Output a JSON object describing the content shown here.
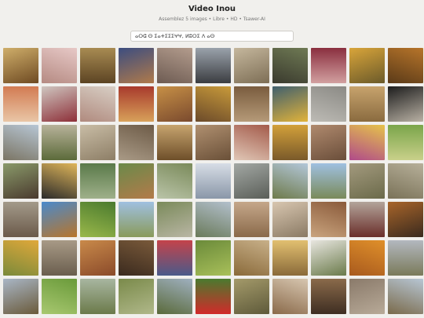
{
  "header": {
    "title": "Video Inou",
    "subtitle": "Assemblez 5 images • Libre • HD • Tsawer-AI"
  },
  "search": {
    "value": "ⴰⵔⵛ ⵙ ⵉⴰⵜⵉⵉⵉⵖⵖ, ⵍⵓⵔⵉ ⴷ ⴰⵙ",
    "placeholder": ""
  },
  "gallery": {
    "tiles": [
      {
        "colors": [
          "#cfae6a",
          "#6e4a22"
        ]
      },
      {
        "colors": [
          "#e7c9c7",
          "#b58a82"
        ]
      },
      {
        "colors": [
          "#a88b52",
          "#5c4423"
        ]
      },
      {
        "colors": [
          "#3c4d80",
          "#b07a4a"
        ]
      },
      {
        "colors": [
          "#b39c8d",
          "#6d5b52"
        ]
      },
      {
        "colors": [
          "#9aa2ab",
          "#3b3d41"
        ]
      },
      {
        "colors": [
          "#c5b79d",
          "#7d6e55"
        ]
      },
      {
        "colors": [
          "#6f7a54",
          "#3a3a2e"
        ]
      },
      {
        "colors": [
          "#8a2f3f",
          "#d2a0a0"
        ]
      },
      {
        "colors": [
          "#d9a53a",
          "#6b5a2a"
        ]
      },
      {
        "colors": [
          "#b7752a",
          "#5a3a18"
        ]
      },
      {
        "colors": [
          "#d27b52",
          "#e9c6a6"
        ]
      },
      {
        "colors": [
          "#cfc6c0",
          "#8d2f38"
        ]
      },
      {
        "colors": [
          "#d8cfc5",
          "#b08a7e"
        ]
      },
      {
        "colors": [
          "#a83a2c",
          "#d8a15a"
        ]
      },
      {
        "colors": [
          "#c79046",
          "#7a4a2e"
        ]
      },
      {
        "colors": [
          "#c89a3a",
          "#6b4a2a"
        ]
      },
      {
        "colors": [
          "#7a5c3e",
          "#b59a78"
        ]
      },
      {
        "colors": [
          "#3f5f6e",
          "#e2b33a"
        ]
      },
      {
        "colors": [
          "#8b8a85",
          "#bdbbb5"
        ]
      },
      {
        "colors": [
          "#c7a36d",
          "#8a6b3f"
        ]
      },
      {
        "colors": [
          "#1c1c1c",
          "#b9b1a4"
        ]
      },
      {
        "colors": [
          "#b7c6d4",
          "#7b7564"
        ]
      },
      {
        "colors": [
          "#b7b29a",
          "#5c6b3a"
        ]
      },
      {
        "colors": [
          "#c9bda6",
          "#8d7e66"
        ]
      },
      {
        "colors": [
          "#6d5b47",
          "#a99a86"
        ]
      },
      {
        "colors": [
          "#c7a46e",
          "#6e4f2a"
        ]
      },
      {
        "colors": [
          "#b09070",
          "#6a5038"
        ]
      },
      {
        "colors": [
          "#a35a4a",
          "#e0c7b6"
        ]
      },
      {
        "colors": [
          "#d2a03a",
          "#7a5a2a"
        ]
      },
      {
        "colors": [
          "#b08a6e",
          "#6a4e3a"
        ]
      },
      {
        "colors": [
          "#e6c34a",
          "#b04a8a"
        ]
      },
      {
        "colors": [
          "#7aa54a",
          "#c9d08a"
        ]
      },
      {
        "colors": [
          "#8a9a6a",
          "#4a3a2e"
        ]
      },
      {
        "colors": [
          "#e0b65a",
          "#2a2a2a"
        ]
      },
      {
        "colors": [
          "#5a7a4a",
          "#9fb08a"
        ]
      },
      {
        "colors": [
          "#6a8a4a",
          "#b37a4a"
        ]
      },
      {
        "colors": [
          "#7a8a5a",
          "#bac4a8"
        ]
      },
      {
        "colors": [
          "#d7dde6",
          "#8a97a8"
        ]
      },
      {
        "colors": [
          "#a3a8a4",
          "#5a5e58"
        ]
      },
      {
        "colors": [
          "#b3c7d9",
          "#6e7a4a"
        ]
      },
      {
        "colors": [
          "#9fc0e0",
          "#7a8a5a"
        ]
      },
      {
        "colors": [
          "#a39a7e",
          "#6b6a4a"
        ]
      },
      {
        "colors": [
          "#b7b09a",
          "#7a7258"
        ]
      },
      {
        "colors": [
          "#a39a8a",
          "#6b5a4a"
        ]
      },
      {
        "colors": [
          "#4a8acc",
          "#b8752a"
        ]
      },
      {
        "colors": [
          "#4a7a2e",
          "#9ab84a"
        ]
      },
      {
        "colors": [
          "#9fc0e0",
          "#8a9a5a"
        ]
      },
      {
        "colors": [
          "#7a8a5a",
          "#b9b6a4"
        ]
      },
      {
        "colors": [
          "#b3c0cc",
          "#6a7a5a"
        ]
      },
      {
        "colors": [
          "#c5a78a",
          "#8a6a4a"
        ]
      },
      {
        "colors": [
          "#d8c6b0",
          "#8a7a64"
        ]
      },
      {
        "colors": [
          "#8a5a3a",
          "#c9a47e"
        ]
      },
      {
        "colors": [
          "#b3a49a",
          "#6a2e2a"
        ]
      },
      {
        "colors": [
          "#a8652a",
          "#3a2a1e"
        ]
      },
      {
        "colors": [
          "#e0a83a",
          "#7a8a3a"
        ]
      },
      {
        "colors": [
          "#a89a86",
          "#6a5e4e"
        ]
      },
      {
        "colors": [
          "#c98a4a",
          "#8a4a2a"
        ]
      },
      {
        "colors": [
          "#7a5a3a",
          "#3a2a1e"
        ]
      },
      {
        "colors": [
          "#c4434a",
          "#4a5a8a"
        ]
      },
      {
        "colors": [
          "#6a8a3a",
          "#a9c05a"
        ]
      },
      {
        "colors": [
          "#c8b089",
          "#8a6a3a"
        ]
      },
      {
        "colors": [
          "#e2c070",
          "#8a6a3a"
        ]
      },
      {
        "colors": [
          "#e8e6e0",
          "#6a7a4a"
        ]
      },
      {
        "colors": [
          "#e0902a",
          "#a85a1e"
        ]
      },
      {
        "colors": [
          "#b3b8bf",
          "#7a7a5a"
        ]
      },
      {
        "colors": [
          "#a9b6c6",
          "#6a5a3a"
        ]
      },
      {
        "colors": [
          "#6a9a3a",
          "#a8c870"
        ]
      },
      {
        "colors": [
          "#a8b6a0",
          "#6b7a4a"
        ]
      },
      {
        "colors": [
          "#7a8a4a",
          "#b0b88a"
        ]
      },
      {
        "colors": [
          "#9fb0bf",
          "#5a6a3a"
        ]
      },
      {
        "colors": [
          "#4a7a2e",
          "#d22a2a"
        ]
      },
      {
        "colors": [
          "#a49a6a",
          "#5e5a3a"
        ]
      },
      {
        "colors": [
          "#d7c6b0",
          "#8a6a4a"
        ]
      },
      {
        "colors": [
          "#8a6a4a",
          "#3e2e22"
        ]
      },
      {
        "colors": [
          "#8a7a6a",
          "#b8aa98"
        ]
      },
      {
        "colors": [
          "#b7c6d4",
          "#7a6a4a"
        ]
      }
    ]
  }
}
